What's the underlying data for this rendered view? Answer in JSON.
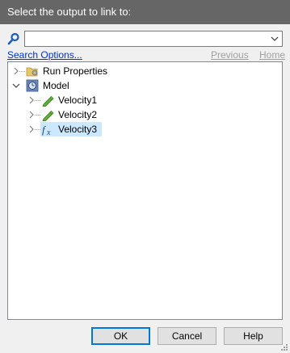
{
  "window": {
    "title": "Select the output to link to:"
  },
  "search": {
    "value": "",
    "placeholder": ""
  },
  "links": {
    "search_options": "Search Options...",
    "previous": "Previous",
    "home": "Home"
  },
  "tree": {
    "items": [
      {
        "label": "Run Properties",
        "icon": "folder-gear-icon",
        "expanded": false,
        "level": 0
      },
      {
        "label": "Model",
        "icon": "model-clock-icon",
        "expanded": true,
        "level": 0
      },
      {
        "label": "Velocity1",
        "icon": "pencil-icon",
        "expanded": false,
        "level": 1
      },
      {
        "label": "Velocity2",
        "icon": "pencil-icon",
        "expanded": false,
        "level": 1
      },
      {
        "label": "Velocity3",
        "icon": "function-fx-icon",
        "expanded": false,
        "level": 1,
        "selected": true
      }
    ]
  },
  "buttons": {
    "ok": "OK",
    "cancel": "Cancel",
    "help": "Help"
  },
  "colors": {
    "titlebar": "#666666",
    "selection": "#cce8ff",
    "link": "#0033cc",
    "default_button_border": "#0078d7"
  }
}
